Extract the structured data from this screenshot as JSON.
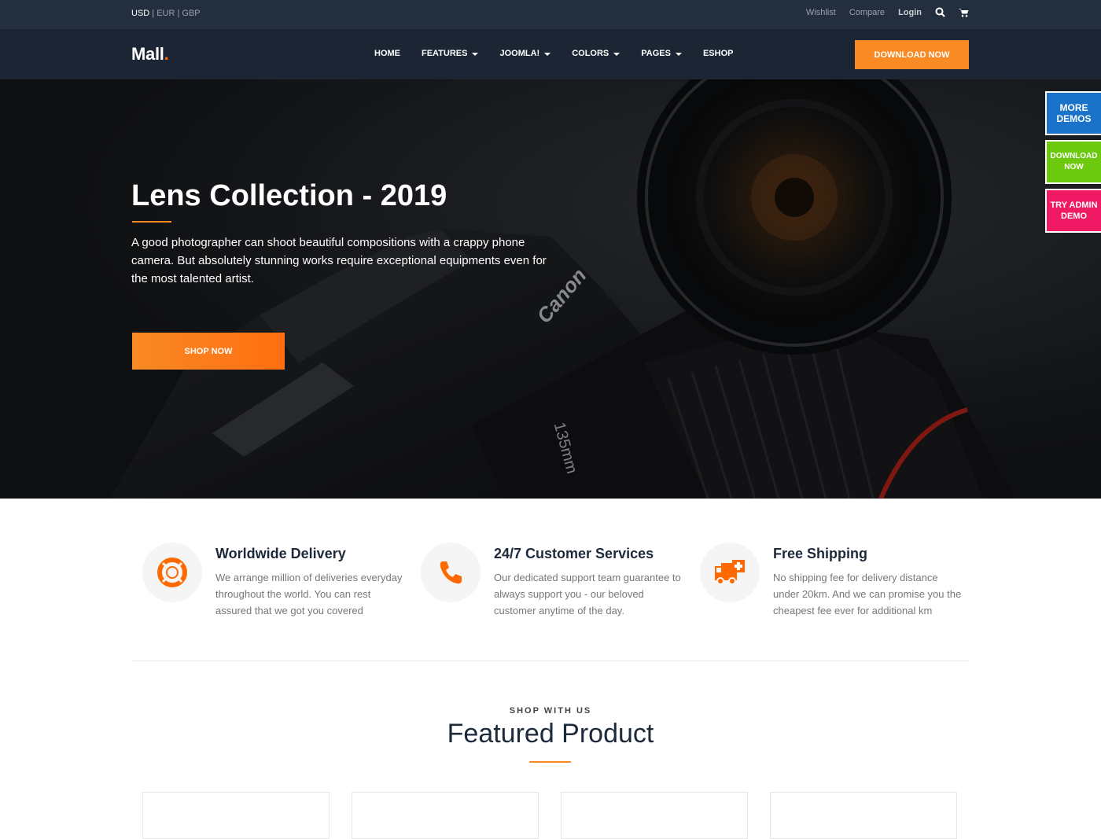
{
  "topbar": {
    "currency_active": "USD",
    "currency_others": " | EUR | GBP",
    "links": {
      "wishlist": "Wishlist",
      "compare": "Compare",
      "login": "Login"
    }
  },
  "navbar": {
    "logo_text": "Mall",
    "logo_dot": ".",
    "menu": [
      "HOME",
      "FEATURES",
      "JOOMLA!",
      "COLORS",
      "PAGES",
      "ESHOP"
    ],
    "download_label": "DOWNLOAD NOW"
  },
  "hero": {
    "title": "Lens Collection - 2019",
    "text": "A good photographer can shoot beautiful compositions with a crappy phone camera. But absolutely stunning works require exceptional equipments even for the most talented artist.",
    "button_label": "SHOP NOW"
  },
  "side_buttons": [
    "MORE DEMOS",
    "DOWNLOAD NOW",
    "TRY ADMIN DEMO"
  ],
  "features": [
    {
      "icon": "lifebuoy-icon",
      "title": "Worldwide Delivery",
      "text": "We arrange million of deliveries everyday throughout the world. You can rest assured that we got you covered"
    },
    {
      "icon": "phone-icon",
      "title": "24/7 Customer Services",
      "text": "Our dedicated support team guarantee to always support you - our beloved customer anytime of the day."
    },
    {
      "icon": "ambulance-truck-icon",
      "title": "Free Shipping",
      "text": "No shipping fee for delivery distance under 20km. And we can promise you the cheapest fee ever for additional km"
    }
  ],
  "featured": {
    "subtitle": "SHOP WITH US",
    "title": "Featured Product"
  },
  "colors": {
    "accent": "#f98a24",
    "topbar": "#232f3e",
    "navbar": "#1c2533",
    "demo_blue": "#1a73c9",
    "demo_green": "#6cc90d",
    "demo_pink": "#ef1a63"
  }
}
